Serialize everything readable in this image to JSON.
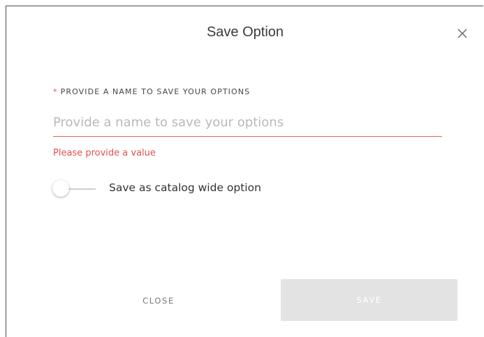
{
  "dialog": {
    "title": "Save Option",
    "close_icon": "close-icon"
  },
  "form": {
    "required_marker": "*",
    "field_label": "PROVIDE A NAME TO SAVE YOUR OPTIONS",
    "name_value": "",
    "name_placeholder": "Provide a name to save your options",
    "error_message": "Please provide a value",
    "toggle_label": "Save as catalog wide option",
    "toggle_on": false
  },
  "actions": {
    "close_label": "CLOSE",
    "save_label": "SAVE",
    "save_disabled": true
  },
  "colors": {
    "error": "#e05050",
    "disabled_button": "#e3e3e3",
    "text": "#333333"
  }
}
